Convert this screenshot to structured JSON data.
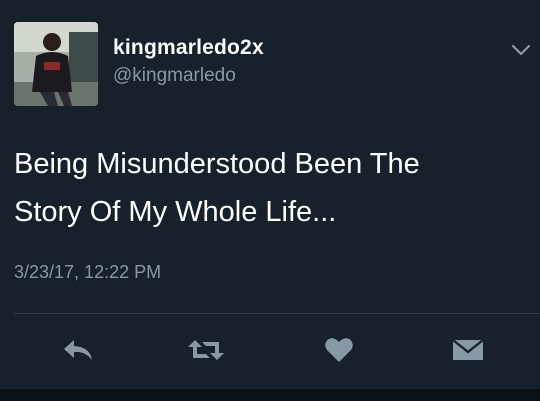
{
  "tweet": {
    "display_name": "kingmarledo2x",
    "handle": "@kingmarledo",
    "text_line1": "Being Misunderstood Been The",
    "text_line2": "Story Of My Whole Life...",
    "timestamp": "3/23/17, 12:22 PM"
  },
  "icons": {
    "menu": "chevron-down-icon",
    "reply": "reply-icon",
    "retweet": "retweet-icon",
    "like": "heart-icon",
    "dm": "direct-message-icon"
  },
  "colors": {
    "background": "#16212c",
    "primary_text": "#ffffff",
    "secondary_text": "#8899a6",
    "icon": "#8899a6"
  }
}
